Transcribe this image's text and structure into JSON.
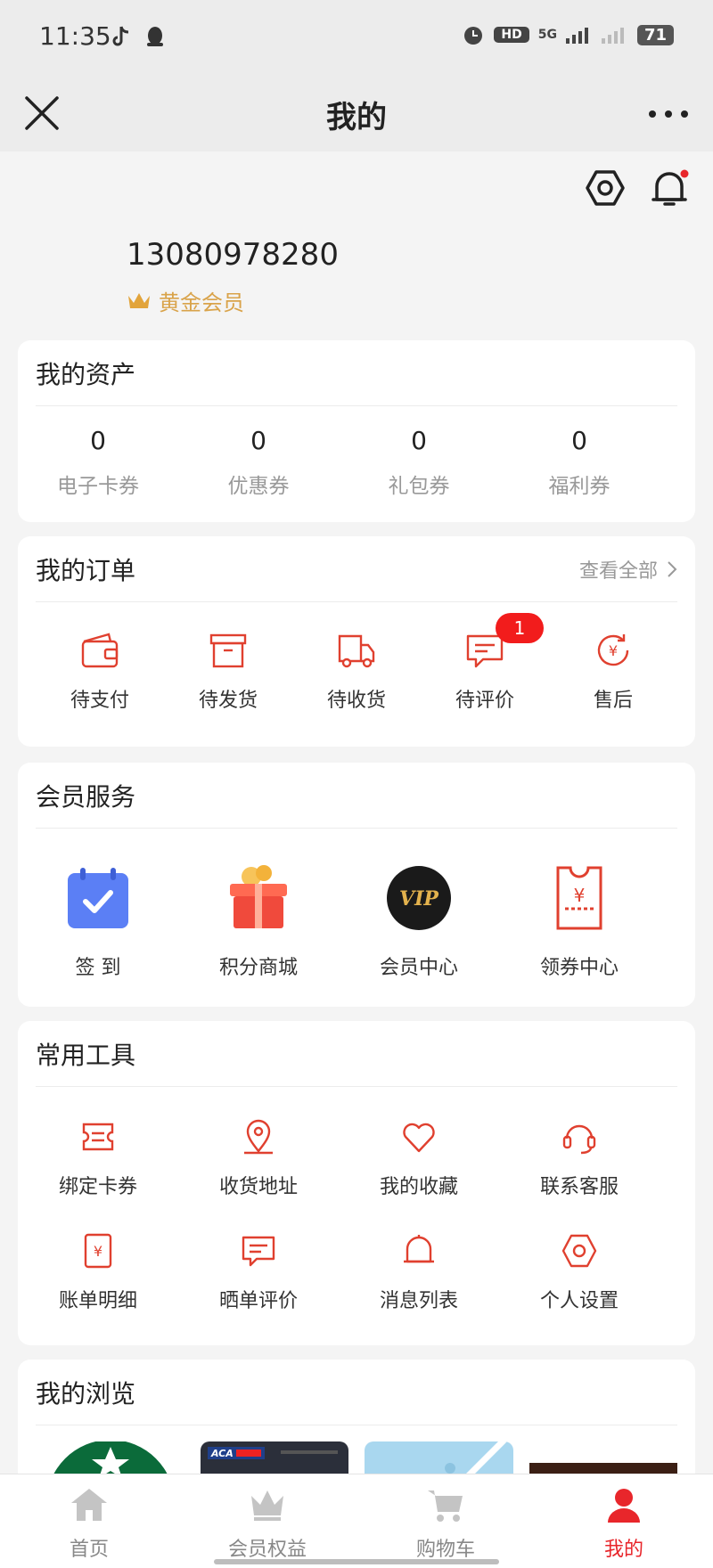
{
  "status_bar": {
    "time": "11:35",
    "battery": "71",
    "network": "5G",
    "hd": "HD"
  },
  "header": {
    "title": "我的"
  },
  "profile": {
    "phone": "13080978280",
    "level": "黄金会员"
  },
  "assets": {
    "title": "我的资产",
    "items": [
      {
        "value": "0",
        "label": "电子卡券"
      },
      {
        "value": "0",
        "label": "优惠券"
      },
      {
        "value": "0",
        "label": "礼包券"
      },
      {
        "value": "0",
        "label": "福利券"
      }
    ]
  },
  "orders": {
    "title": "我的订单",
    "view_all": "查看全部",
    "items": [
      {
        "label": "待支付",
        "icon": "wallet-icon"
      },
      {
        "label": "待发货",
        "icon": "box-icon"
      },
      {
        "label": "待收货",
        "icon": "truck-icon"
      },
      {
        "label": "待评价",
        "icon": "comment-icon",
        "badge": "1"
      },
      {
        "label": "售后",
        "icon": "refund-icon"
      }
    ]
  },
  "services": {
    "title": "会员服务",
    "items": [
      {
        "label": "签 到",
        "icon": "calendar-check-icon"
      },
      {
        "label": "积分商城",
        "icon": "gift-icon"
      },
      {
        "label": "会员中心",
        "icon": "vip-icon",
        "icon_text": "VIP"
      },
      {
        "label": "领券中心",
        "icon": "coupon-icon"
      }
    ]
  },
  "tools": {
    "title": "常用工具",
    "items": [
      {
        "label": "绑定卡券",
        "icon": "ticket-icon"
      },
      {
        "label": "收货地址",
        "icon": "location-icon"
      },
      {
        "label": "我的收藏",
        "icon": "heart-icon"
      },
      {
        "label": "联系客服",
        "icon": "headset-icon"
      },
      {
        "label": "账单明细",
        "icon": "bill-icon"
      },
      {
        "label": "晒单评价",
        "icon": "review-icon"
      },
      {
        "label": "消息列表",
        "icon": "bell-icon"
      },
      {
        "label": "个人设置",
        "icon": "settings-icon"
      }
    ]
  },
  "browse": {
    "title": "我的浏览",
    "thumb2_text": "ACA"
  },
  "tabbar": {
    "items": [
      {
        "label": "首页",
        "icon": "home-icon"
      },
      {
        "label": "会员权益",
        "icon": "crown-icon"
      },
      {
        "label": "购物车",
        "icon": "cart-icon"
      },
      {
        "label": "我的",
        "icon": "user-icon",
        "active": true
      }
    ]
  },
  "colors": {
    "accent": "#e8262b",
    "gold": "#d9a34a",
    "icon_red": "#e0402f"
  }
}
